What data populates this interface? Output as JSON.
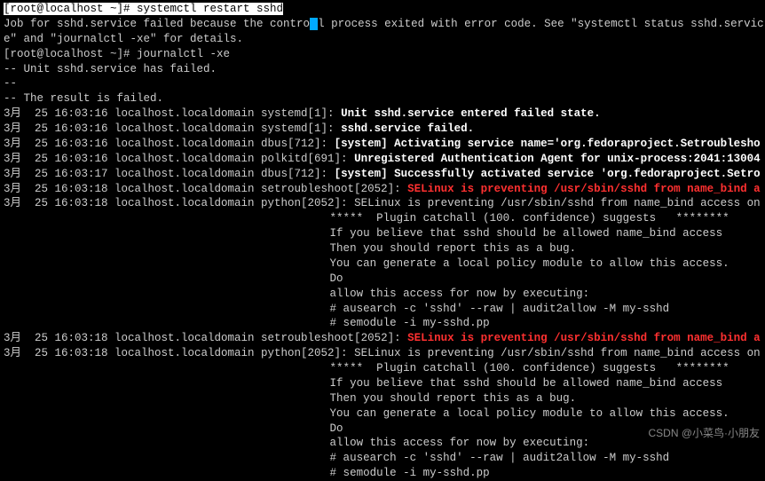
{
  "prompt": "[root@localhost ~]# ",
  "cmd1": "systemctl restart sshd",
  "err1": "Job for sshd.service failed because the control process exited with error code. See \"systemctl status sshd.servic",
  "err2": "e\" and \"journalctl -xe\" for details.",
  "cmd2": "journalctl -xe",
  "u1": "-- Unit sshd.service has failed.",
  "u2": "--",
  "u3": "-- The result is failed.",
  "log": [
    {
      "ts": "3月  25 16:03:16 localhost.localdomain systemd[1]: ",
      "msg": "Unit sshd.service entered failed state.",
      "cls": "bold"
    },
    {
      "ts": "3月  25 16:03:16 localhost.localdomain systemd[1]: ",
      "msg": "sshd.service failed.",
      "cls": "bold"
    },
    {
      "ts": "3月  25 16:03:16 localhost.localdomain dbus[712]: ",
      "msg": "[system] Activating service name='org.fedoraproject.Setroublesho",
      "cls": "bold"
    },
    {
      "ts": "3月  25 16:03:16 localhost.localdomain polkitd[691]: ",
      "msg": "Unregistered Authentication Agent for unix-process:2041:13004",
      "cls": "bold"
    },
    {
      "ts": "3月  25 16:03:17 localhost.localdomain dbus[712]: ",
      "msg": "[system] Successfully activated service 'org.fedoraproject.Setro",
      "cls": "bold"
    },
    {
      "ts": "3月  25 16:03:18 localhost.localdomain setroubleshoot[2052]: ",
      "msg": "SELinux is preventing /usr/sbin/sshd from name_bind a",
      "cls": "red"
    },
    {
      "ts": "3月  25 16:03:18 localhost.localdomain python[2052]: ",
      "msg": "SELinux is preventing /usr/sbin/sshd from name_bind access on",
      "cls": ""
    }
  ],
  "block": [
    "",
    "                                                 *****  Plugin catchall (100. confidence) suggests   ********",
    "",
    "                                                 If you believe that sshd should be allowed name_bind access",
    "                                                 Then you should report this as a bug.",
    "                                                 You can generate a local policy module to allow this access.",
    "                                                 Do",
    "                                                 allow this access for now by executing:",
    "                                                 # ausearch -c 'sshd' --raw | audit2allow -M my-sshd",
    "                                                 # semodule -i my-sshd.pp",
    ""
  ],
  "log2": [
    {
      "ts": "3月  25 16:03:18 localhost.localdomain setroubleshoot[2052]: ",
      "msg": "SELinux is preventing /usr/sbin/sshd from name_bind a",
      "cls": "red"
    },
    {
      "ts": "3月  25 16:03:18 localhost.localdomain python[2052]: ",
      "msg": "SELinux is preventing /usr/sbin/sshd from name_bind access on",
      "cls": ""
    }
  ],
  "watermark": "CSDN @小菜鸟·小朋友"
}
